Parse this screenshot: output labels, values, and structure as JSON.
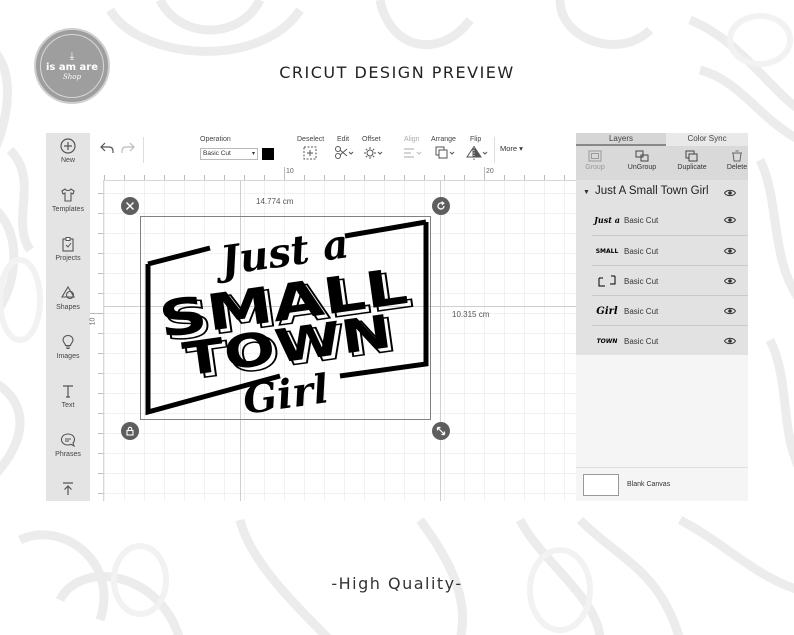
{
  "badge": {
    "main": "is am are",
    "sub": "Shop"
  },
  "page_title": "CRICUT DESIGN PREVIEW",
  "footer_text": "-High Quality-",
  "left_panel": {
    "items": [
      {
        "label": "New",
        "icon": "plus-circle-icon"
      },
      {
        "label": "Templates",
        "icon": "shirt-icon"
      },
      {
        "label": "Projects",
        "icon": "clipboard-icon"
      },
      {
        "label": "Shapes",
        "icon": "shapes-icon"
      },
      {
        "label": "Images",
        "icon": "bulb-icon"
      },
      {
        "label": "Text",
        "icon": "text-icon"
      },
      {
        "label": "Phrases",
        "icon": "speech-icon"
      }
    ]
  },
  "toolbar": {
    "operation_label": "Operation",
    "operation_value": "Basic Cut",
    "deselect_label": "Deselect",
    "edit_label": "Edit",
    "offset_label": "Offset",
    "align_label": "Align",
    "arrange_label": "Arrange",
    "flip_label": "Flip",
    "more_label": "More"
  },
  "ruler": {
    "top_ticks": [
      "10",
      "20"
    ],
    "left_ticks": [
      "10"
    ]
  },
  "canvas": {
    "width_label": "14.774 cm",
    "height_label": "10.315 cm",
    "design_lines": [
      "Just a",
      "SMALL",
      "TOWN",
      "Girl"
    ]
  },
  "layers_panel": {
    "tabs": [
      "Layers",
      "Color Sync"
    ],
    "actions": [
      "Group",
      "UnGroup",
      "Duplicate",
      "Delete"
    ],
    "group_name": "Just A Small Town Girl",
    "layers": [
      {
        "thumb": "Just a",
        "operation": "Basic Cut"
      },
      {
        "thumb": "SMALL",
        "operation": "Basic Cut"
      },
      {
        "thumb": "",
        "operation": "Basic Cut"
      },
      {
        "thumb": "Girl",
        "operation": "Basic Cut"
      },
      {
        "thumb": "TOWN",
        "operation": "Basic Cut"
      }
    ],
    "blank_canvas_label": "Blank Canvas"
  },
  "colors": {
    "panel_gray": "#e4e4e4",
    "handle": "#5e5e5e",
    "artwork": "#000000",
    "grid_line": "#e3e3e3"
  }
}
